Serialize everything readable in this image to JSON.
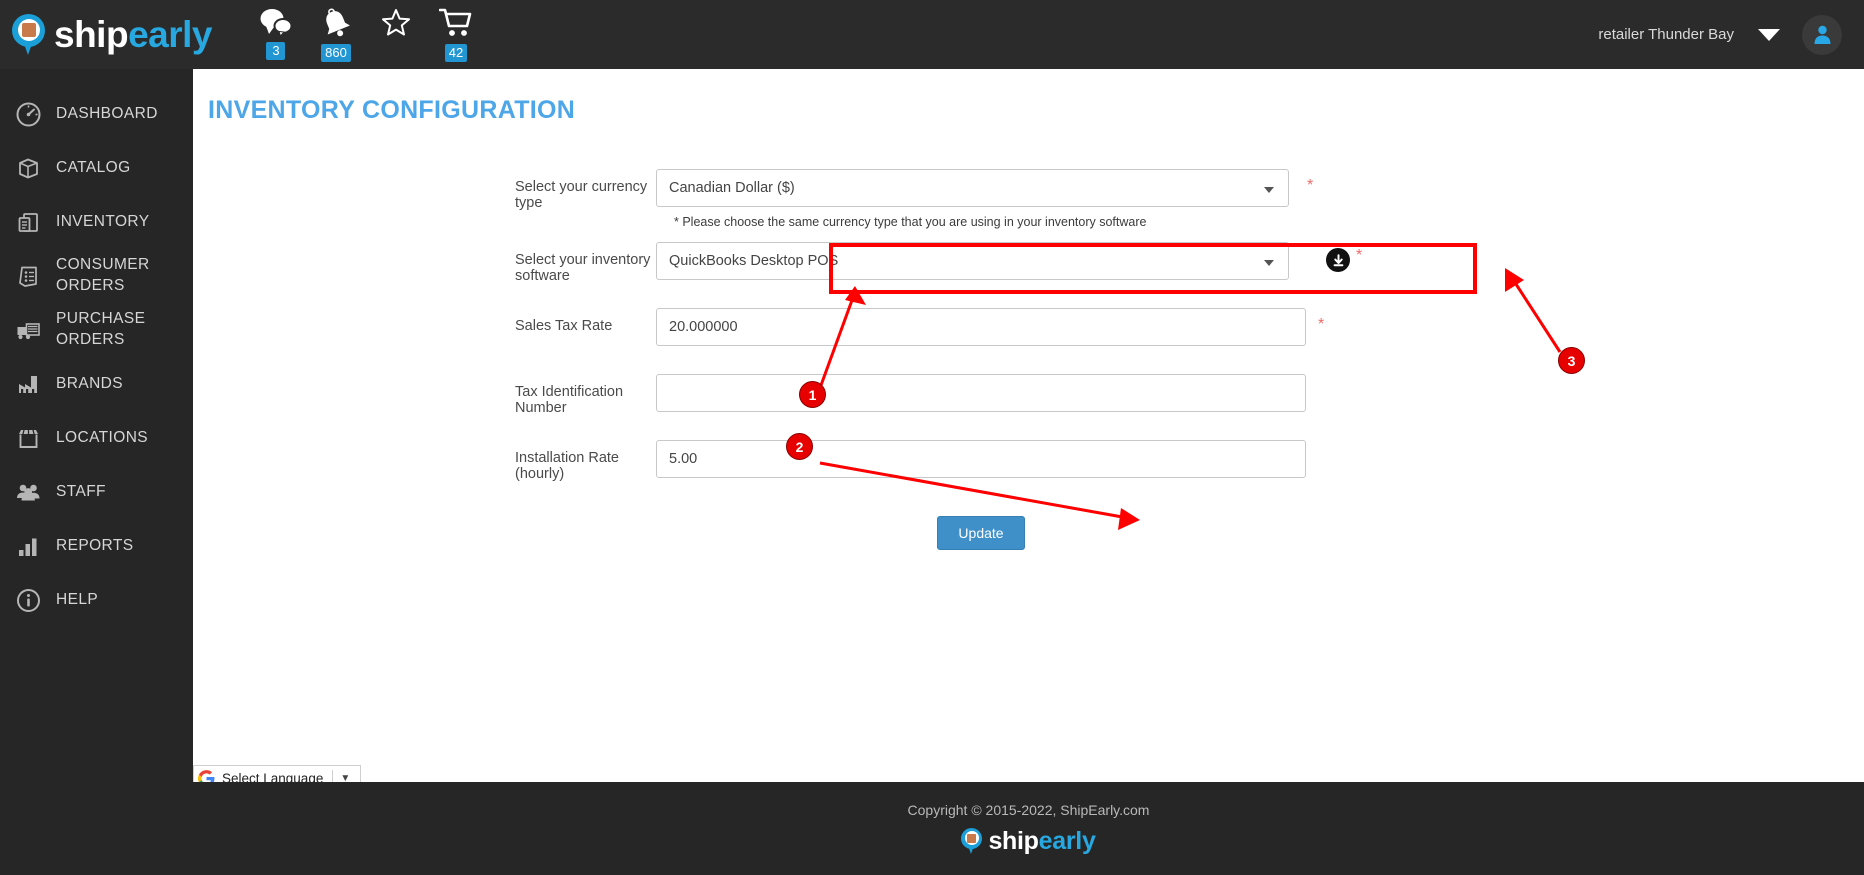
{
  "header": {
    "brand": {
      "part1": "ship",
      "part2": "early"
    },
    "icons": [
      {
        "name": "messages-icon",
        "badge": "3"
      },
      {
        "name": "notifications-bell-icon",
        "badge": "860"
      },
      {
        "name": "favorites-star-icon",
        "badge": ""
      },
      {
        "name": "cart-icon",
        "badge": "42"
      }
    ],
    "user_label": "retailer Thunder Bay"
  },
  "sidebar": {
    "items": [
      {
        "label": "DASHBOARD",
        "icon": "speedometer-icon"
      },
      {
        "label": "CATALOG",
        "icon": "box-icon"
      },
      {
        "label": "INVENTORY",
        "icon": "inventory-boxes-icon"
      },
      {
        "label": "CONSUMER ORDERS",
        "icon": "document-list-icon"
      },
      {
        "label": "PURCHASE ORDERS",
        "icon": "delivery-truck-icon"
      },
      {
        "label": "BRANDS",
        "icon": "factory-icon"
      },
      {
        "label": "LOCATIONS",
        "icon": "storefront-icon"
      },
      {
        "label": "STAFF",
        "icon": "people-group-icon"
      },
      {
        "label": "REPORTS",
        "icon": "bar-chart-icon"
      },
      {
        "label": "HELP",
        "icon": "info-circle-icon"
      }
    ]
  },
  "main": {
    "title": "INVENTORY CONFIGURATION",
    "fields": {
      "currency": {
        "label": "Select your currency type",
        "value": "Canadian Dollar ($)",
        "hint": "* Please choose the same currency type that you are using in your inventory software",
        "required_mark": "*"
      },
      "software": {
        "label": "Select your inventory software",
        "value": "QuickBooks Desktop POS",
        "required_mark": "*"
      },
      "sales_tax": {
        "label": "Sales Tax Rate",
        "value": "20.000000",
        "required_mark": "*"
      },
      "tax_id": {
        "label": "Tax Identification Number",
        "value": "",
        "placeholder": ""
      },
      "installation_rate": {
        "label": "Installation Rate (hourly)",
        "value": "5.00",
        "placeholder": ""
      }
    },
    "update_button": "Update"
  },
  "annotations": {
    "markers": [
      {
        "id": "1",
        "label": "1"
      },
      {
        "id": "2",
        "label": "2"
      },
      {
        "id": "3",
        "label": "3"
      }
    ],
    "highlight_color": "#ff0000",
    "marker_color": "#e60000"
  },
  "translate": {
    "label": "Select Language",
    "caret": "▼"
  },
  "footer": {
    "copyright": "Copyright © 2015-2022, ShipEarly.com",
    "brand": {
      "part1": "ship",
      "part2": "early"
    }
  },
  "colors": {
    "accent": "#27a8e0",
    "title": "#4da6e8",
    "button": "#3f8fc9",
    "badge": "#2196d3",
    "sidebar_bg": "#262626",
    "topbar_bg": "#2b2b2b"
  }
}
